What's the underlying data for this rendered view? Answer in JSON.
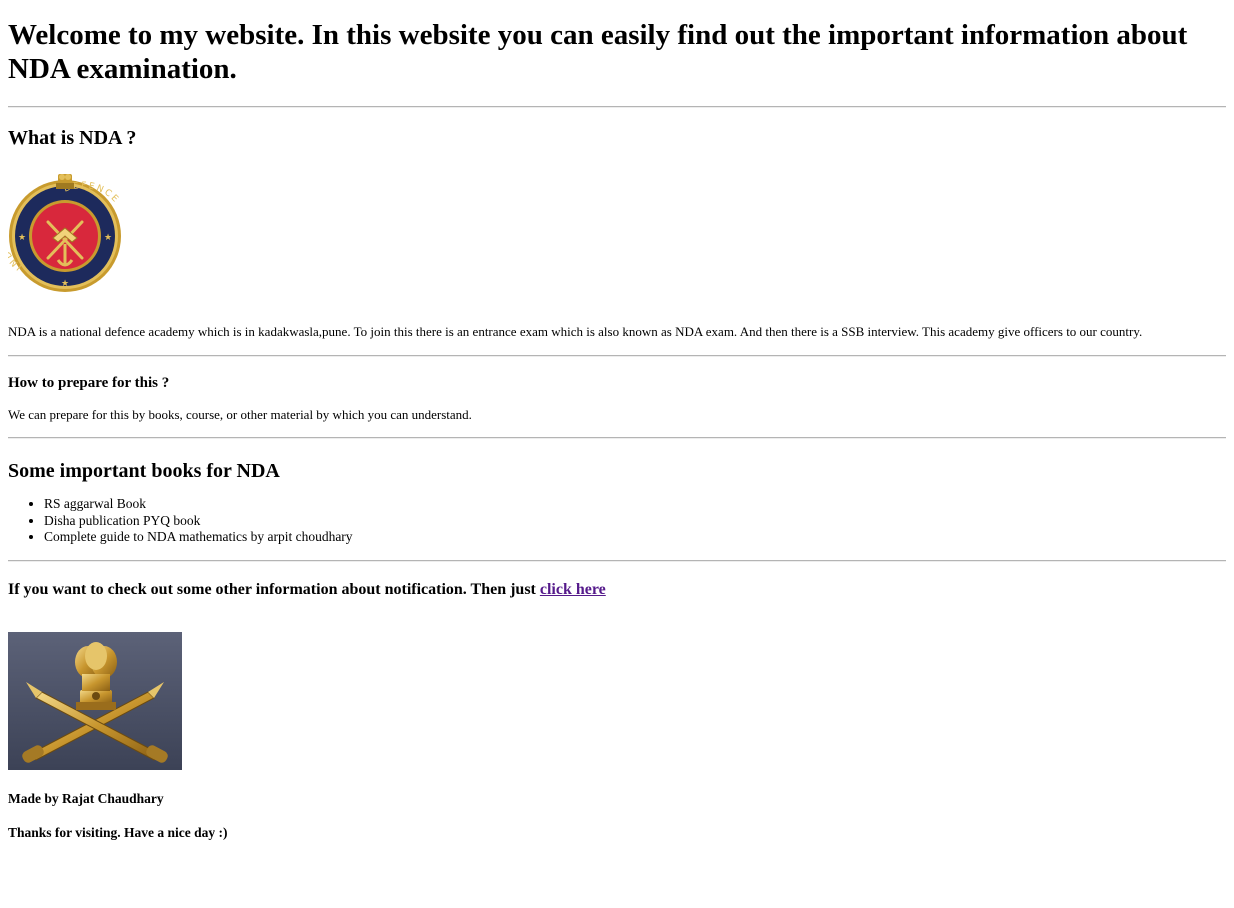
{
  "header": {
    "title": "Welcome to my website. In this website you can easily find out the important information about NDA examination."
  },
  "section_nda": {
    "heading": "What is NDA ?",
    "emblem_text_left": "INDIAN",
    "emblem_text_right": "DEFENCE",
    "paragraph": "NDA is a national defence academy which is in kadakwasla,pune. To join this there is an entrance exam which is also known as NDA exam. And then there is a SSB interview. This academy give officers to our country."
  },
  "section_prepare": {
    "heading": "How to prepare for this ?",
    "paragraph": "We can prepare for this by books, course, or other material by which you can understand."
  },
  "section_books": {
    "heading": "Some important books for NDA",
    "items": [
      "RS aggarwal Book",
      "Disha publication PYQ book",
      "Complete guide to NDA mathematics by arpit choudhary"
    ]
  },
  "notification": {
    "text": "If you want to check out some other information about notification. Then just ",
    "link_label": "click here"
  },
  "footer": {
    "made_by": "Made by Rajat Chaudhary",
    "thanks": "Thanks for visiting. Have a nice day :)"
  },
  "colors": {
    "link_visited": "#551a8b",
    "divider": "#b4b4b4",
    "emblem_red": "#d8283c",
    "emblem_navy": "#1d2a5c",
    "emblem_gold": "#c89b2e",
    "army_bg": "#4a5064"
  }
}
